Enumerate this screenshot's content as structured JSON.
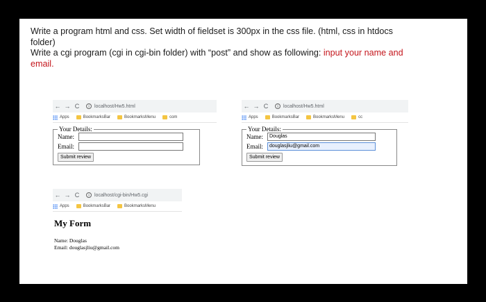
{
  "assignment": {
    "line1": "Write a program html and css. Set width of fieldset is 300px in the css file. (html, css in htdocs folder)",
    "line2_prefix": "Write a cgi program (cgi in cgi-bin folder) with “post” and show as following: ",
    "line2_highlight": "input your name and email."
  },
  "browser1": {
    "url": "localhost/Hw5.html",
    "bookmarks": [
      "Apps",
      "BookmarksBar",
      "BookmarksMenu",
      "com"
    ],
    "form": {
      "legend": "Your Details:",
      "name_label": "Name:",
      "name_value": "",
      "email_label": "Email:",
      "email_value": "",
      "submit_label": "Submit review"
    }
  },
  "browser2": {
    "url": "localhost/Hw5.html",
    "bookmarks": [
      "Apps",
      "BookmarksBar",
      "BookmarksMenu",
      "cc"
    ],
    "form": {
      "legend": "Your Details:",
      "name_label": "Name:",
      "name_value": "Douglas",
      "email_label": "Email:",
      "email_value": "douglasjliu@gmail.com",
      "submit_label": "Submit review"
    }
  },
  "browser3": {
    "url": "localhost/cgi-bin/Hw5.cgi",
    "bookmarks": [
      "Apps",
      "BookmarksBar",
      "BookmarksMenu"
    ],
    "result": {
      "title": "My Form",
      "name_line": "Name: Douglas",
      "email_line": "Email: douglasjliu@gmail.com"
    }
  },
  "icons": {
    "back": "←",
    "forward": "→",
    "reload": "C",
    "info": "i"
  }
}
